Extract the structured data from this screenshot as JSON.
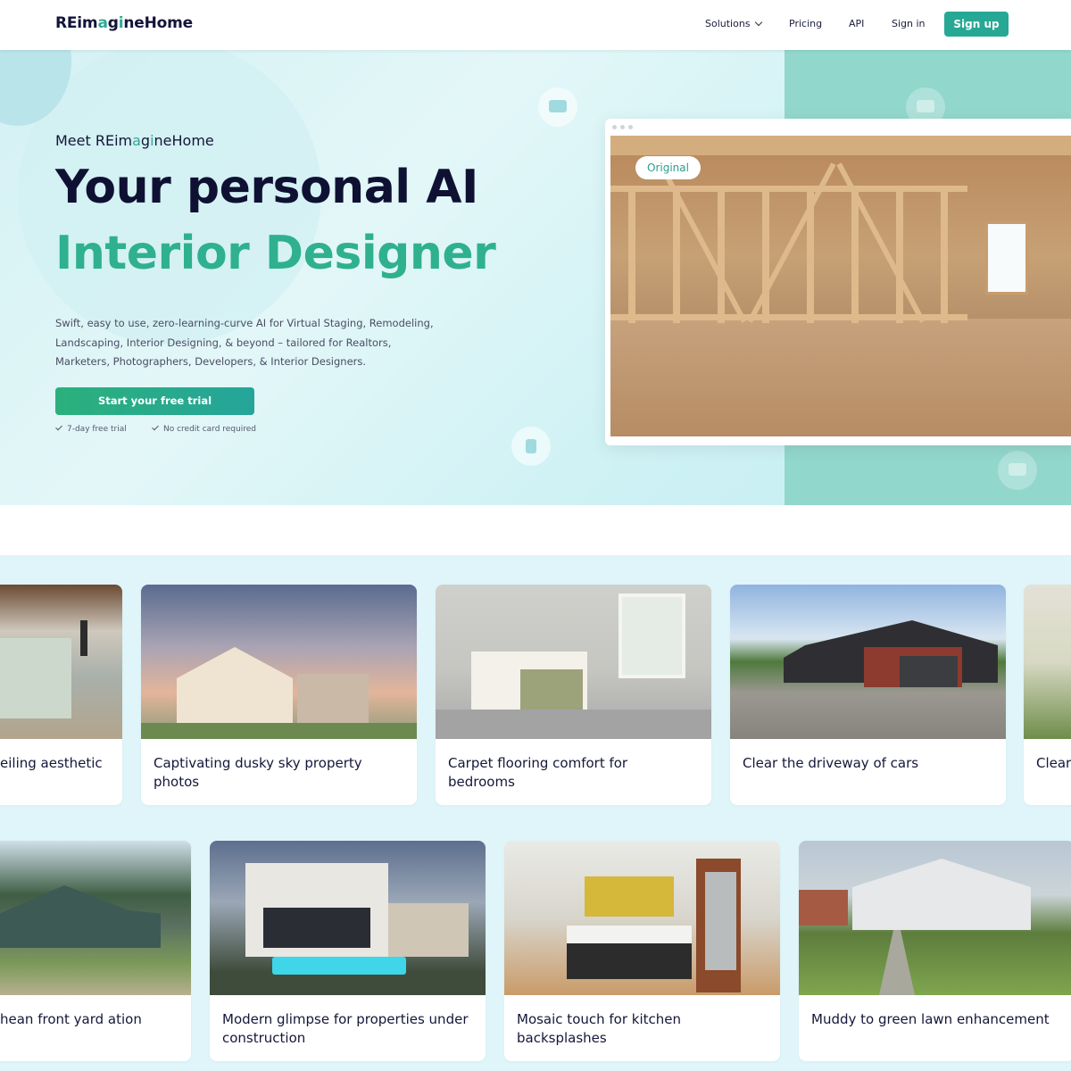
{
  "nav": {
    "logo_pre": "REim",
    "logo_accent_1": "a",
    "logo_mid": "g",
    "logo_accent_2": "i",
    "logo_post": "neHome",
    "solutions": "Solutions",
    "pricing": "Pricing",
    "api": "API",
    "signin": "Sign in",
    "signup": "Sign up"
  },
  "hero": {
    "meet_pre": "Meet REim",
    "meet_accent_1": "a",
    "meet_mid": "g",
    "meet_accent_2": "i",
    "meet_post": "neHome",
    "title_line1": "Your personal AI",
    "title_line2": "Interior Designer",
    "description": "Swift, easy to use, zero-learning-curve AI for Virtual Staging, Remodeling, Landscaping, Interior Designing, & beyond – tailored for Realtors, Marketers, Photographers, Developers, & Interior Designers.",
    "cta": "Start your free trial",
    "check1": "7-day free trial",
    "check2": "No credit card required",
    "image_badge": "Original"
  },
  "gallery": {
    "row1": [
      {
        "caption": "eiling aesthetic"
      },
      {
        "caption": "Captivating dusky sky property photos"
      },
      {
        "caption": "Carpet flooring comfort for bedrooms"
      },
      {
        "caption": "Clear the driveway of cars"
      },
      {
        "caption": "Clear"
      }
    ],
    "row2": [
      {
        "caption": "hean front yard ation"
      },
      {
        "caption": "Modern glimpse for properties under construction"
      },
      {
        "caption": "Mosaic touch for kitchen backsplashes"
      },
      {
        "caption": "Muddy to green lawn enhancement"
      }
    ]
  },
  "colors": {
    "brand": "#26a894",
    "accent_text": "#2fb08f",
    "dark_text": "#0f1133"
  }
}
